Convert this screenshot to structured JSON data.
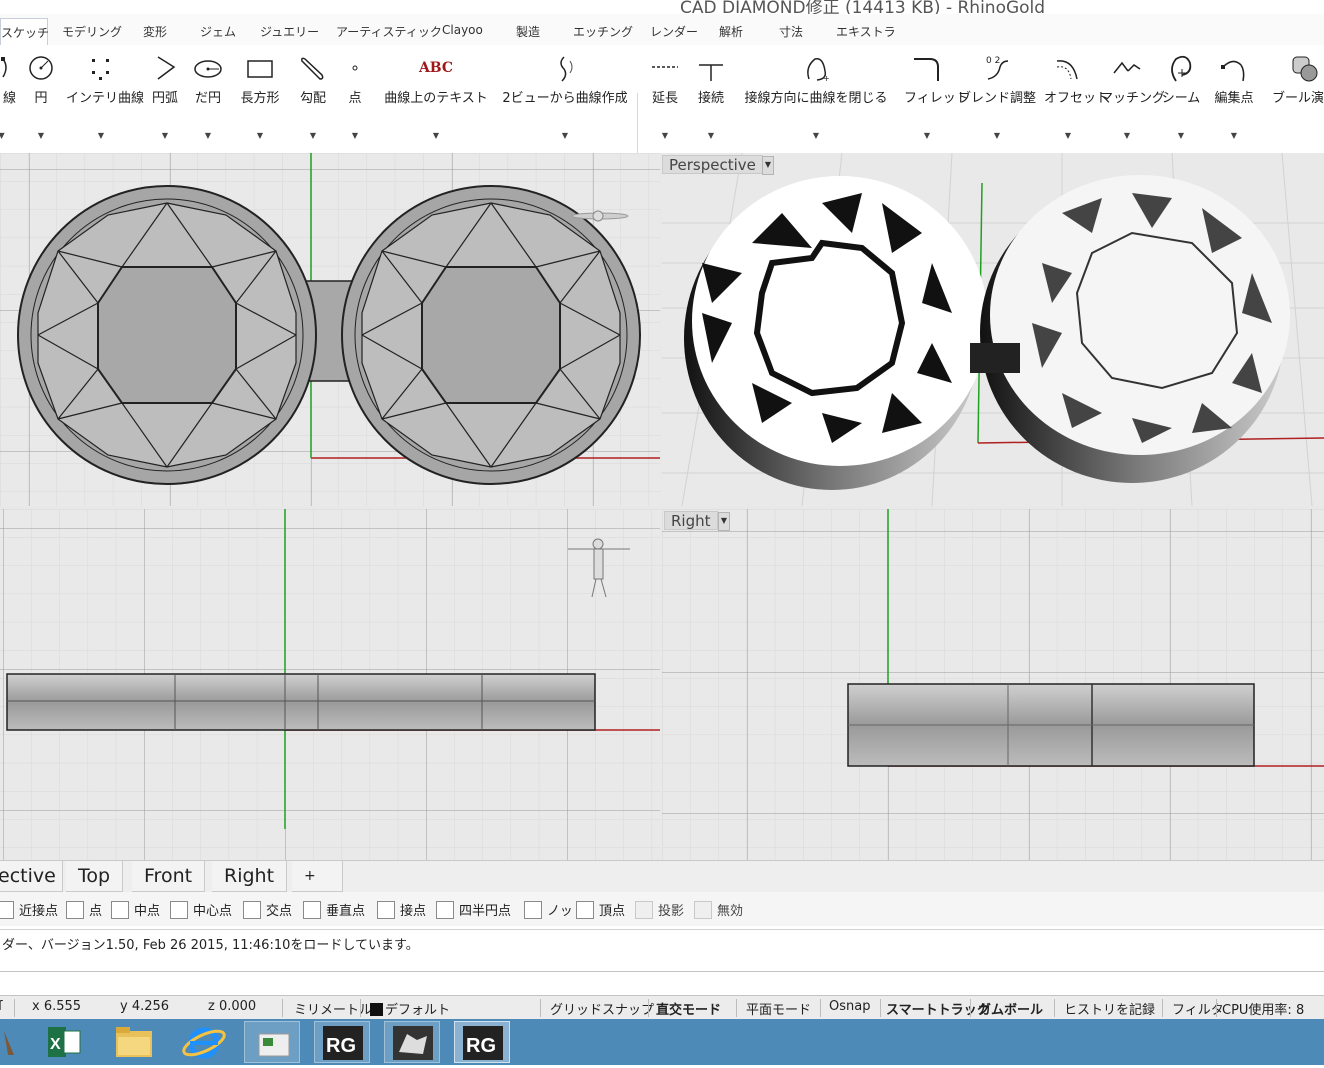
{
  "window": {
    "title": "CAD DIAMOND修正 (14413 KB) - RhinoGold"
  },
  "menu": {
    "tabs": [
      "スケッチ",
      "モデリング",
      "変形",
      "ジェム",
      "ジュエリー",
      "アーティスティック",
      "Clayoo",
      "製造",
      "エッチング",
      "レンダー",
      "解析",
      "寸法",
      "エキストラ"
    ]
  },
  "ribbon": {
    "tools": [
      {
        "name": "curve",
        "label": "線"
      },
      {
        "name": "circle",
        "label": "円"
      },
      {
        "name": "interp-curve",
        "label": "インテリ曲線"
      },
      {
        "name": "arc",
        "label": "円弧"
      },
      {
        "name": "ellipse",
        "label": "だ円"
      },
      {
        "name": "rectangle",
        "label": "長方形"
      },
      {
        "name": "gradient",
        "label": "勾配"
      },
      {
        "name": "point",
        "label": "点"
      },
      {
        "name": "text-on-curve",
        "label": "曲線上のテキスト"
      },
      {
        "name": "curve-from-2-views",
        "label": "2ビューから曲線作成"
      },
      {
        "name": "extend",
        "label": "延長"
      },
      {
        "name": "connect",
        "label": "接続"
      },
      {
        "name": "close-tangent",
        "label": "接線方向に曲線を閉じる"
      },
      {
        "name": "fillet",
        "label": "フィレット"
      },
      {
        "name": "adjust-blend",
        "label": "ブレンド調整"
      },
      {
        "name": "offset",
        "label": "オフセット"
      },
      {
        "name": "match",
        "label": "マッチング"
      },
      {
        "name": "seam",
        "label": "シーム"
      },
      {
        "name": "edit-points",
        "label": "編集点"
      },
      {
        "name": "boolean",
        "label": "ブール演算"
      }
    ],
    "abc": "ABC",
    "dims": "0 2"
  },
  "viewports": {
    "top": "Top",
    "perspective": "Perspective",
    "front": "Front",
    "right": "Right"
  },
  "view_tabs": [
    "ective",
    "Top",
    "Front",
    "Right"
  ],
  "osnap": {
    "items": [
      "近接点",
      "点",
      "中点",
      "中心点",
      "交点",
      "垂直点",
      "接点",
      "四半円点",
      "ノット",
      "頂点"
    ],
    "project": "投影",
    "disable": "無効"
  },
  "command": {
    "history": "ダー、バージョン1.50, Feb 26 2015, 11:46:10をロードしています。"
  },
  "status": {
    "plane": "ſ",
    "x": "x 6.555",
    "y": "y 4.256",
    "z": "z 0.000",
    "units": "ミリメートル",
    "layer": "デフォルト",
    "grid_snap": "グリッドスナップ",
    "ortho": "直交モード",
    "planar": "平面モード",
    "osnap": "Osnap",
    "smart_track": "スマートトラック",
    "gumball": "ガムボール",
    "history": "ヒストリを記録",
    "filter": "フィルタ",
    "cpu": "CPU使用率: 8"
  },
  "taskbar": {
    "apps": [
      "tool-icon",
      "excel-icon",
      "explorer-icon",
      "ie-icon",
      "folder-doc-icon",
      "rhinogold-icon",
      "rhino-icon",
      "rhinogold-icon"
    ],
    "rg1": "RG",
    "rg2": "RG"
  },
  "colors": {
    "menu_bg": "#fafafa",
    "viewport_bg": "#e8e8e8",
    "grid_minor": "#d8d8d8",
    "grid_major": "#9a9a9a",
    "axis_x": "#b02020",
    "axis_y": "#20a020",
    "taskbar": "#4d8ab8"
  }
}
